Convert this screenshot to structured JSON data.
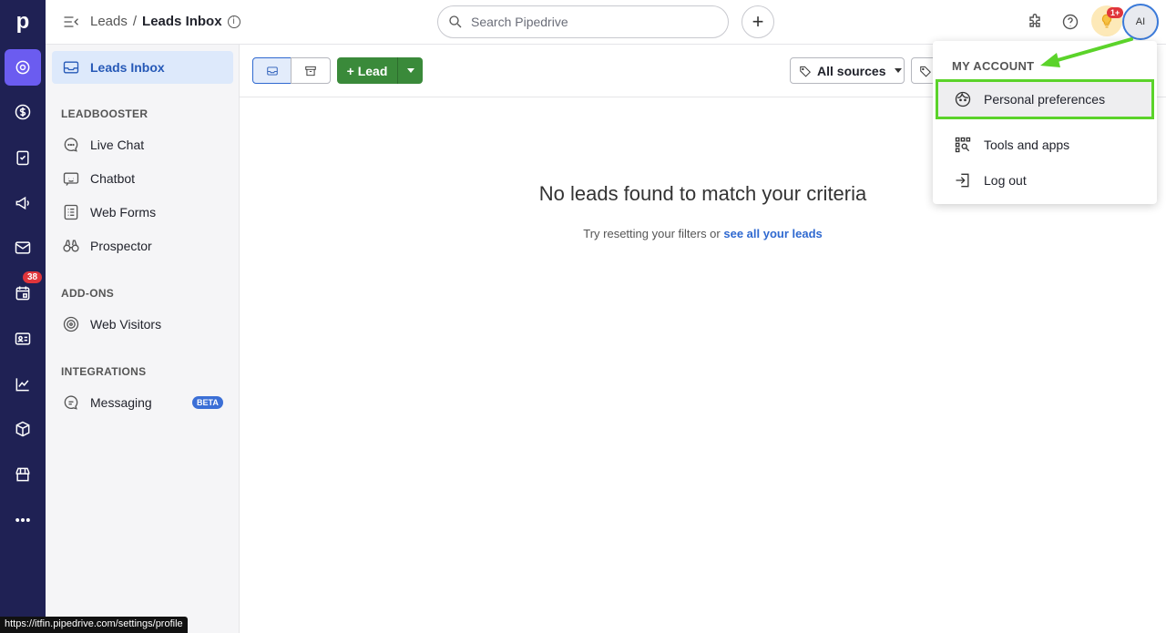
{
  "app": {
    "logo": "p"
  },
  "header": {
    "breadcrumb_root": "Leads",
    "breadcrumb_sep": "/",
    "breadcrumb_current": "Leads Inbox",
    "info_glyph": "i",
    "search_placeholder": "Search Pipedrive",
    "add_glyph": "+",
    "notification_count": "1+",
    "avatar_initials": "AI"
  },
  "rail": {
    "activity_badge": "38"
  },
  "sidebar": {
    "inbox_label": "Leads Inbox",
    "section_leadbooster": "LEADBOOSTER",
    "live_chat": "Live Chat",
    "chatbot": "Chatbot",
    "web_forms": "Web Forms",
    "prospector": "Prospector",
    "section_addons": "ADD-ONS",
    "web_visitors": "Web Visitors",
    "section_integrations": "INTEGRATIONS",
    "messaging": "Messaging",
    "beta_badge": "BETA"
  },
  "toolbar": {
    "add_lead_label": "+ Lead",
    "sources_filter": "All sources"
  },
  "empty_state": {
    "title": "No leads found to match your criteria",
    "hint_prefix": "Try resetting your filters or ",
    "hint_link": "see all your leads"
  },
  "account_menu": {
    "heading": "MY ACCOUNT",
    "personal_preferences": "Personal preferences",
    "tools_and_apps": "Tools and apps",
    "log_out": "Log out"
  },
  "status_bar": {
    "url": "https://itfin.pipedrive.com/settings/profile"
  },
  "colors": {
    "rail_bg": "#1f2154",
    "rail_active": "#6b5cf0",
    "primary_green": "#3a8a3a",
    "link_blue": "#2f69d0",
    "highlight_green": "#5bd32a"
  }
}
